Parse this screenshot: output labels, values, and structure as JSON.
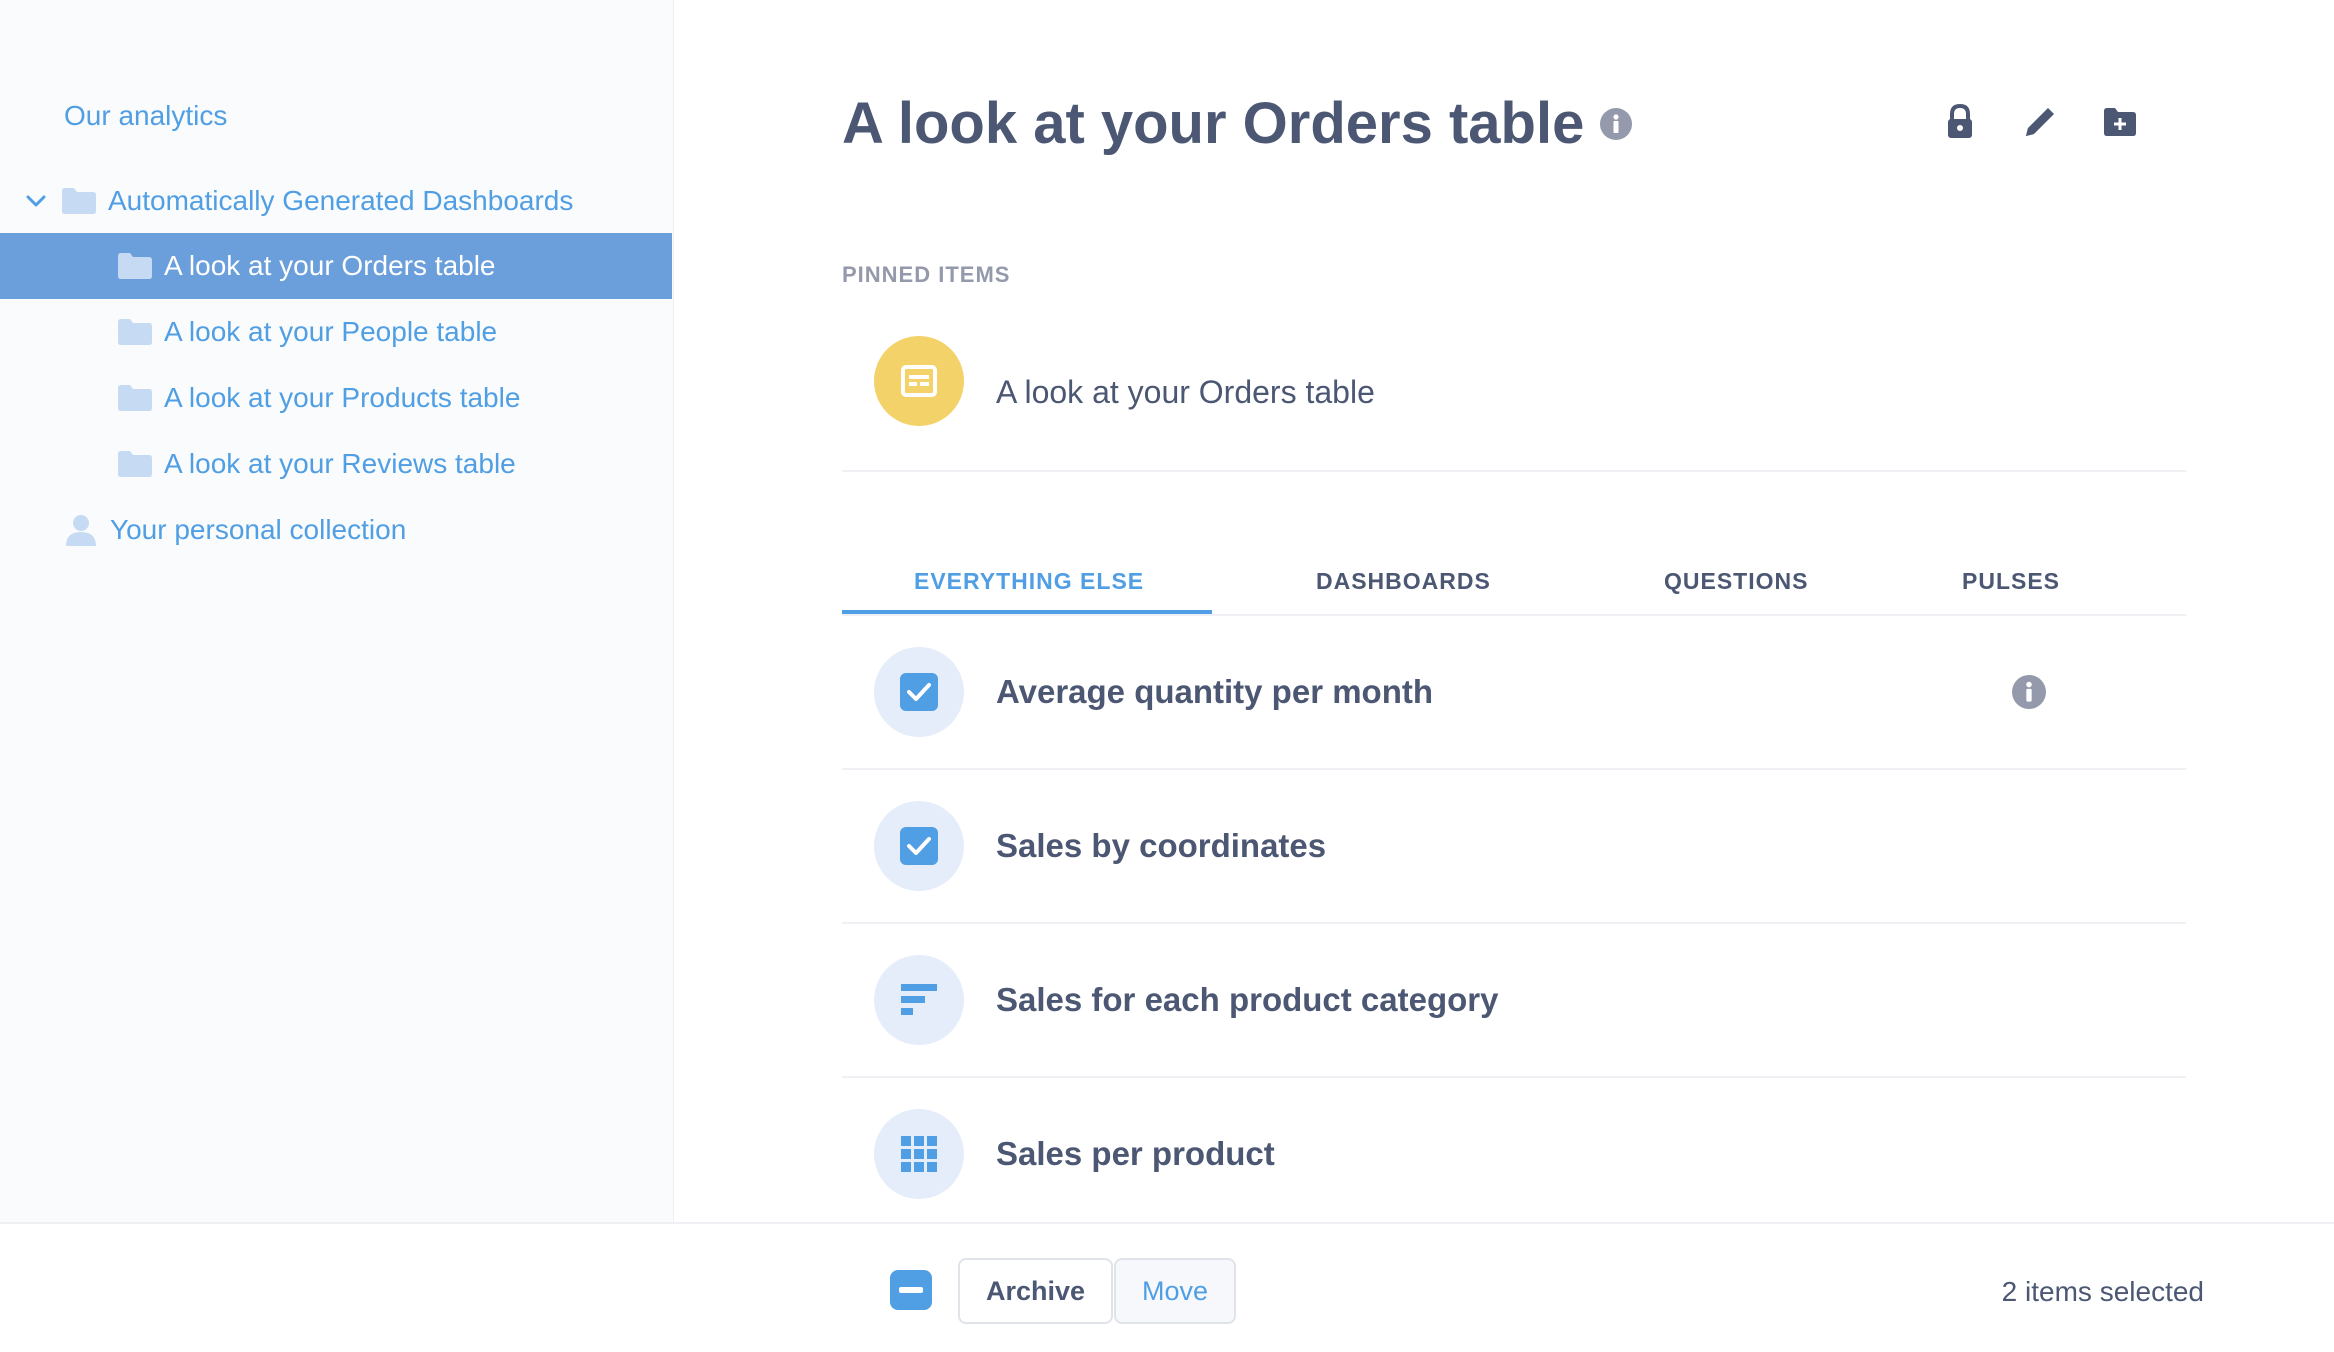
{
  "sidebar": {
    "root_label": "Our analytics",
    "items": [
      {
        "label": "Automatically Generated Dashboards"
      },
      {
        "label": "A look at your Orders table"
      },
      {
        "label": "A look at your People table"
      },
      {
        "label": "A look at your Products table"
      },
      {
        "label": "A look at your Reviews table"
      },
      {
        "label": "Your personal collection"
      }
    ],
    "active_item": "A look at your Orders table"
  },
  "header": {
    "title": "A look at your Orders table",
    "icons": [
      "info-icon",
      "lock-icon",
      "pencil-icon",
      "new-folder-icon"
    ]
  },
  "pinned": {
    "label": "PINNED ITEMS",
    "items": [
      {
        "name": "A look at your Orders table",
        "icon": "dashboard-icon"
      }
    ]
  },
  "tabs": [
    {
      "label": "EVERYTHING ELSE",
      "active": true
    },
    {
      "label": "DASHBOARDS"
    },
    {
      "label": "QUESTIONS"
    },
    {
      "label": "PULSES"
    }
  ],
  "items": [
    {
      "name": "Average quantity per month",
      "icon": "checked-checkbox-icon",
      "selected": true
    },
    {
      "name": "Sales by coordinates",
      "icon": "checked-checkbox-icon",
      "selected": true
    },
    {
      "name": "Sales for each product category",
      "icon": "bar-chart-icon"
    },
    {
      "name": "Sales per product",
      "icon": "table-grid-icon"
    }
  ],
  "bottom_bar": {
    "archive_label": "Archive",
    "move_label": "Move",
    "selected_text": "2 items selected"
  },
  "colors": {
    "brand": "#509ee3",
    "sidebar_active": "#6a9fdc",
    "text_dark": "#4c5773",
    "pinned_yellow": "#f3d26a",
    "icon_bg": "#e4edf9"
  }
}
